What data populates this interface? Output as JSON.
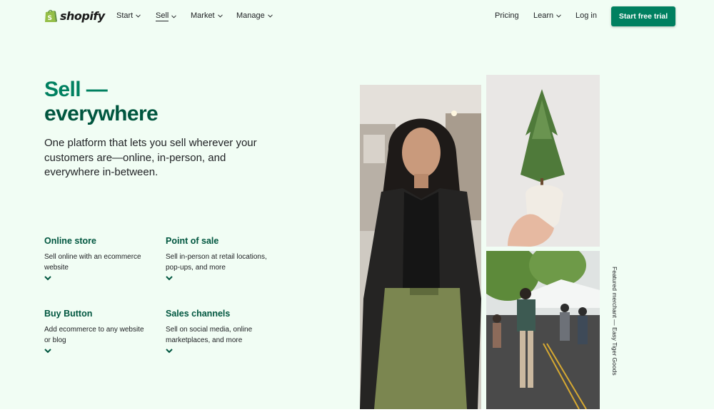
{
  "header": {
    "logo_text": "shopify",
    "nav": [
      {
        "label": "Start"
      },
      {
        "label": "Sell"
      },
      {
        "label": "Market"
      },
      {
        "label": "Manage"
      }
    ],
    "right": {
      "pricing": "Pricing",
      "learn": "Learn",
      "login": "Log in",
      "cta": "Start free trial"
    }
  },
  "hero": {
    "title_line1": "Sell —",
    "title_line2": "everywhere",
    "subtitle": "One platform that lets you sell wherever your customers are—online, in-person, and everywhere in-between."
  },
  "features": [
    {
      "title": "Online store",
      "description": "Sell online with an ecommerce website"
    },
    {
      "title": "Point of sale",
      "description": "Sell in-person at retail locations, pop-ups, and more"
    },
    {
      "title": "Buy Button",
      "description": "Add ecommerce to any website or blog"
    },
    {
      "title": "Sales channels",
      "description": "Sell on social media, online marketplaces, and more"
    }
  ],
  "photos": {
    "featured_caption": "Featured merchant — Easy Tiger Goods"
  },
  "colors": {
    "background": "#f1fdf4",
    "brand_green": "#008060",
    "dark_green": "#00563f",
    "text": "#212326"
  },
  "icons": {
    "logo": "shopping-bag-icon",
    "dropdown": "chevron-down-icon"
  }
}
